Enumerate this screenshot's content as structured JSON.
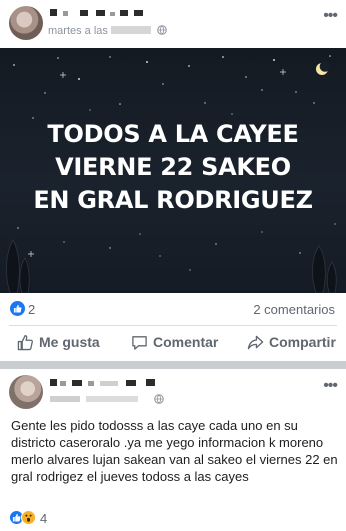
{
  "post1": {
    "meta": "martes a las",
    "banner_lines": [
      "TODOS A LA CAYEE",
      "VIERNE  22 SAKEO",
      "EN GRAL RODRIGUEZ"
    ],
    "reaction_count": "2",
    "comments": "2 comentarios",
    "actions": {
      "like": "Me gusta",
      "comment": "Comentar",
      "share": "Compartir"
    }
  },
  "post2": {
    "body": "Gente les pido todosss a las caye cada uno en su districto  caseroralo .ya me yego informacion k moreno  merlo  alvares  lujan sakean van al sakeo el viernes 22 en gral rodrigez el jueves todoss a las cayes",
    "reaction_count": "4"
  },
  "icons": [
    "globe-icon",
    "more-icon",
    "like-icon",
    "comment-icon",
    "share-icon",
    "wow-icon",
    "moon-icon"
  ],
  "colors": {
    "accent": "#1877f2",
    "banner_bg": "#171e28",
    "secondary_text": "#606770",
    "separator": "#c9ccd1"
  }
}
